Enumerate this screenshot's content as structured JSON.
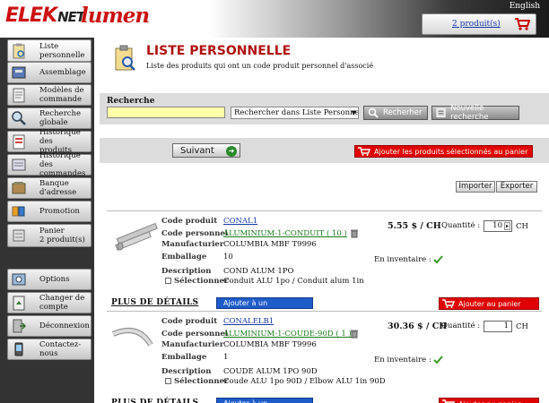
{
  "header": {
    "brand_primary": "ELEK",
    "brand_secondary": "NET",
    "brand_partner": "lumen",
    "language_link": "English",
    "cart_count": "2 produit(s)",
    "cart_icon": "shopping-cart-icon"
  },
  "sidebar": {
    "items": [
      {
        "label": "Liste\npersonnelle",
        "icon": "clipboard-icon",
        "active": true
      },
      {
        "label": "Assemblage",
        "icon": "assembly-icon"
      },
      {
        "label": "Modèles de\ncommande",
        "icon": "template-icon"
      },
      {
        "label": "Recherche\nglobale",
        "icon": "search-icon"
      },
      {
        "label": "Historique des\nproduits",
        "icon": "product-history-icon"
      },
      {
        "label": "Historique des\ncommandes",
        "icon": "order-history-icon"
      },
      {
        "label": "Banque\nd'adresse",
        "icon": "address-book-icon"
      },
      {
        "label": "Promotion",
        "icon": "promotion-icon"
      },
      {
        "label": "Panier\n2 produit(s)",
        "icon": "cart-icon"
      },
      {
        "label": "Options",
        "icon": "options-icon"
      },
      {
        "label": "Changer de\ncompte",
        "icon": "switch-account-icon"
      },
      {
        "label": "Déconnexion",
        "icon": "logout-icon"
      },
      {
        "label": "Contactez-nous",
        "icon": "contact-icon"
      }
    ]
  },
  "page": {
    "title": "LISTE PERSONNELLE",
    "subtitle": "Liste des produits qui ont un code produit personnel d'associé"
  },
  "search": {
    "label": "Recherche",
    "input_value": "",
    "scope_selected": "Rechercher dans Liste Personnelle",
    "search_button": "Recherher",
    "new_search_button": "Nouvelle recherche"
  },
  "actions": {
    "next_button": "Suivant",
    "add_selected_button": "Ajouter les produits sélectionnés au panier",
    "import_button": "Importer",
    "export_button": "Exporter"
  },
  "labels": {
    "code_produit": "Code produit",
    "code_personnel": "Code personnel",
    "manufacturier": "Manufacturier",
    "emballage": "Emballage",
    "description": "Description",
    "selectionner": "Sélectionner",
    "quantite": "Quantité :",
    "en_inventaire": "En inventaire :",
    "plus_de_details": "PLUS DE DÉTAILS",
    "ajouter_assemblage": "Ajouter à un assemblage",
    "ajouter_panier": "Ajouter au panier"
  },
  "products": [
    {
      "code_produit": "CONAL1",
      "code_personnel": "ALUMINIUM-1-CONDUIT ( 10 )",
      "manufacturier": "COLUMBIA MBF T9996",
      "emballage": "10",
      "description": "COND ALUM 1PO",
      "description_2": "Conduit ALU 1po / Conduit alum 1in",
      "price": "5.55 $ / CH",
      "quantity": "10",
      "unit": "CH",
      "in_stock": true
    },
    {
      "code_produit": "CONALELB1",
      "code_personnel": "ALUMINIUM-1-COUDE-90D ( 1 )",
      "manufacturier": "COLUMBIA MBF T9996",
      "emballage": "1",
      "description": "COUDE ALUM 1PO 90D",
      "description_2": "Coude ALU 1po 90D / Elbow ALU 1in 90D",
      "price": "30.36 $ / CH",
      "quantity": "1",
      "unit": "CH",
      "in_stock": true
    }
  ],
  "colors": {
    "brand_red": "#cc1111",
    "button_red": "#e00000",
    "button_blue": "#1e5cc8",
    "link_blue": "#1a3aa8",
    "link_green": "#1a7a1a",
    "sidebar_bg": "#333333",
    "search_input_bg": "#ffffaa"
  }
}
